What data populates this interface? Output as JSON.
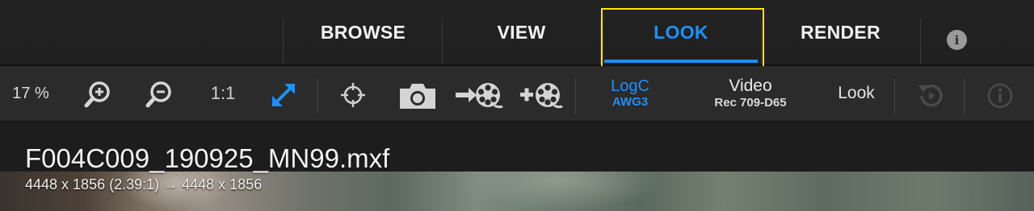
{
  "tabs": [
    {
      "label": "BROWSE",
      "active": false
    },
    {
      "label": "VIEW",
      "active": false
    },
    {
      "label": "LOOK",
      "active": true
    },
    {
      "label": "RENDER",
      "active": false
    }
  ],
  "info_button": {
    "glyph": "i",
    "icon": "info-icon"
  },
  "toolbar": {
    "zoom_percent": "17 %",
    "zoom_in_icon": "zoom-in-icon",
    "zoom_out_icon": "zoom-out-icon",
    "one_to_one": "1:1",
    "fit_icon": "expand-arrows-icon",
    "crosshair_icon": "crosshair-icon",
    "snapshot_icon": "camera-icon",
    "import_reel_icon": "film-reel-arrow-icon",
    "add_reel_icon": "film-reel-plus-icon",
    "input_color": {
      "line1": "LogC",
      "line2": "AWG3"
    },
    "output_color": {
      "line1": "Video",
      "line2": "Rec 709-D65"
    },
    "look_label": "Look",
    "reset_icon": "history-reset-icon",
    "info_icon": "info-circle-icon"
  },
  "clip": {
    "filename": "F004C009_190925_MN99.mxf",
    "resolution": "4448 x 1856 (2.39:1) → 4448 x 1856"
  },
  "colors": {
    "accent": "#1e90ff",
    "highlight_box": "#ffe800",
    "bar_bg": "#2b2b2b",
    "top_bg": "#202020"
  }
}
